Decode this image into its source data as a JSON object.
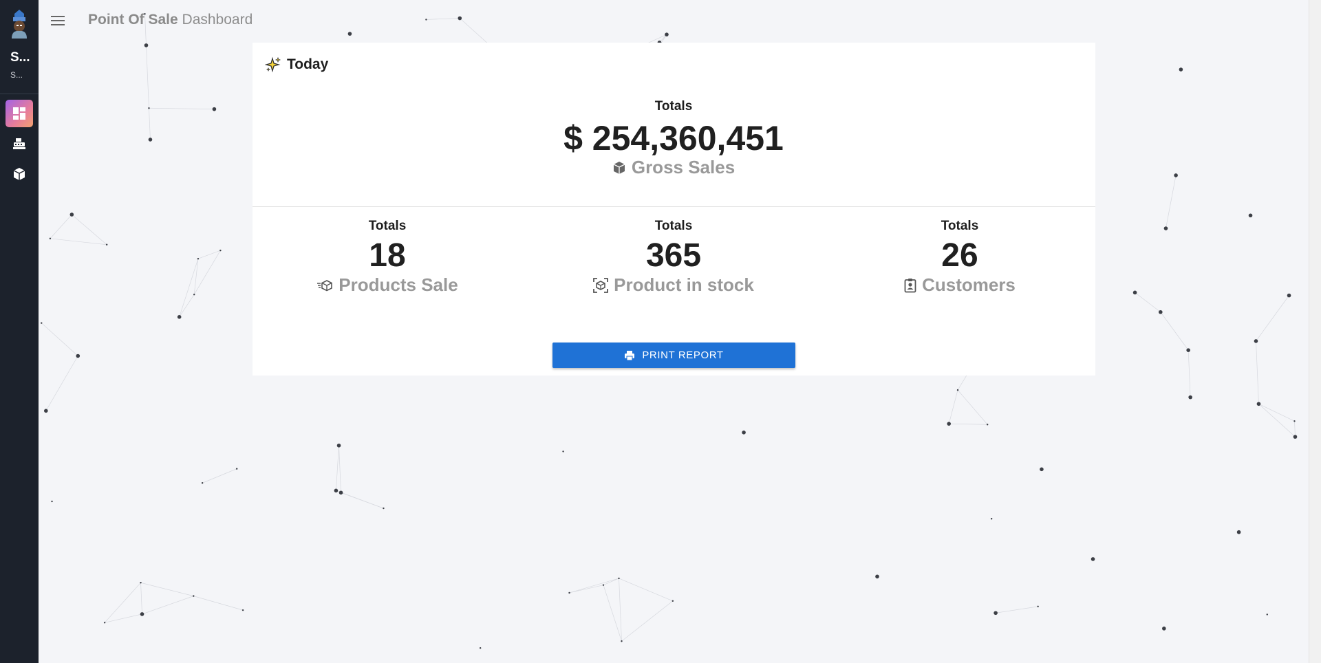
{
  "sidebar": {
    "brand_name": "S...",
    "brand_sub": "S...",
    "items": [
      {
        "icon": "dashboard-icon",
        "active": true
      },
      {
        "icon": "cash-register-icon",
        "active": false
      },
      {
        "icon": "box-icon",
        "active": false
      }
    ]
  },
  "topbar": {
    "title_bold": "Point Of Sale",
    "title_rest": "Dashboard"
  },
  "card": {
    "heading": "Today",
    "gross": {
      "label": "Totals",
      "value": "$ 254,360,451",
      "caption": "Gross Sales",
      "icon": "cube-icon"
    },
    "stats": [
      {
        "label": "Totals",
        "value": "18",
        "caption": "Products Sale",
        "icon": "box-moving-icon"
      },
      {
        "label": "Totals",
        "value": "365",
        "caption": "Product in stock",
        "icon": "box-scan-icon"
      },
      {
        "label": "Totals",
        "value": "26",
        "caption": "Customers",
        "icon": "clipboard-user-icon"
      }
    ],
    "print_label": "PRINT REPORT"
  },
  "colors": {
    "sidebar_bg": "#1c222c",
    "accent": "#1f72d6",
    "page_bg": "#f4f5f8"
  }
}
